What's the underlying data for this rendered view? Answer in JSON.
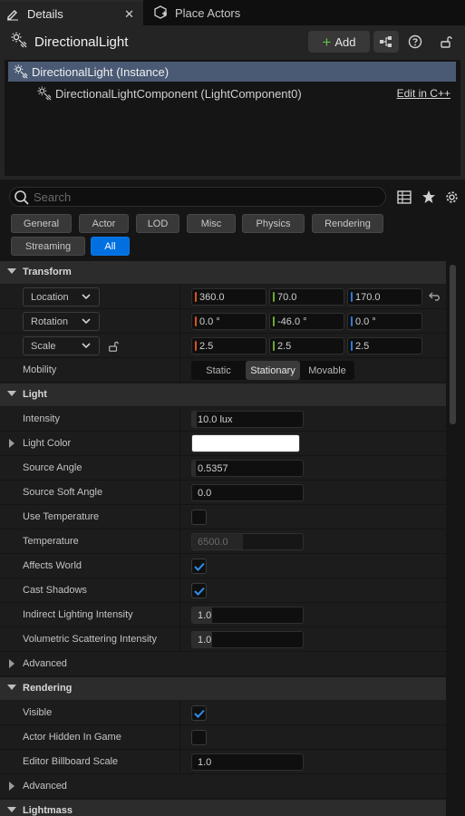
{
  "tabs": {
    "details": {
      "label": "Details",
      "close": "✕"
    },
    "place_actors": {
      "label": "Place Actors"
    }
  },
  "header": {
    "actor_name": "DirectionalLight",
    "add_label": "Add",
    "components": {
      "instance": "DirectionalLight (Instance)",
      "component": "DirectionalLightComponent (LightComponent0)",
      "edit_link": "Edit in C++"
    }
  },
  "search": {
    "placeholder": "Search",
    "value": ""
  },
  "categories": [
    "General",
    "Actor",
    "LOD",
    "Misc",
    "Physics",
    "Rendering",
    "Streaming",
    "All"
  ],
  "active_category": "All",
  "transform": {
    "section_label": "Transform",
    "location": {
      "label": "Location",
      "x": "360.0",
      "y": "70.0",
      "z": "170.0"
    },
    "rotation": {
      "label": "Rotation",
      "x": "0.0 °",
      "y": "-46.0 °",
      "z": "0.0 °"
    },
    "scale": {
      "label": "Scale",
      "x": "2.5",
      "y": "2.5",
      "z": "2.5"
    },
    "mobility": {
      "label": "Mobility",
      "options": [
        "Static",
        "Stationary",
        "Movable"
      ],
      "selected": "Stationary"
    }
  },
  "light": {
    "section_label": "Light",
    "intensity": {
      "label": "Intensity",
      "value": "10.0 lux"
    },
    "light_color": {
      "label": "Light Color",
      "color": "#ffffff"
    },
    "source_angle": {
      "label": "Source Angle",
      "value": "0.5357"
    },
    "source_soft_angle": {
      "label": "Source Soft Angle",
      "value": "0.0"
    },
    "use_temperature": {
      "label": "Use Temperature",
      "checked": false
    },
    "temperature": {
      "label": "Temperature",
      "value": "6500.0"
    },
    "affects_world": {
      "label": "Affects World",
      "checked": true
    },
    "cast_shadows": {
      "label": "Cast Shadows",
      "checked": true
    },
    "indirect_lighting_intensity": {
      "label": "Indirect Lighting Intensity",
      "value": "1.0"
    },
    "volumetric_scattering_intensity": {
      "label": "Volumetric Scattering Intensity",
      "value": "1.0"
    },
    "advanced_label": "Advanced"
  },
  "rendering": {
    "section_label": "Rendering",
    "visible": {
      "label": "Visible",
      "checked": true
    },
    "actor_hidden_in_game": {
      "label": "Actor Hidden In Game",
      "checked": false
    },
    "editor_billboard_scale": {
      "label": "Editor Billboard Scale",
      "value": "1.0"
    },
    "advanced_label": "Advanced"
  },
  "next_section_label": "Lightmass",
  "colors": {
    "accent": "#0070e0",
    "selection": "#4a5a74",
    "x_axis": "#d9531e",
    "y_axis": "#6da832",
    "z_axis": "#2f7bd8"
  }
}
